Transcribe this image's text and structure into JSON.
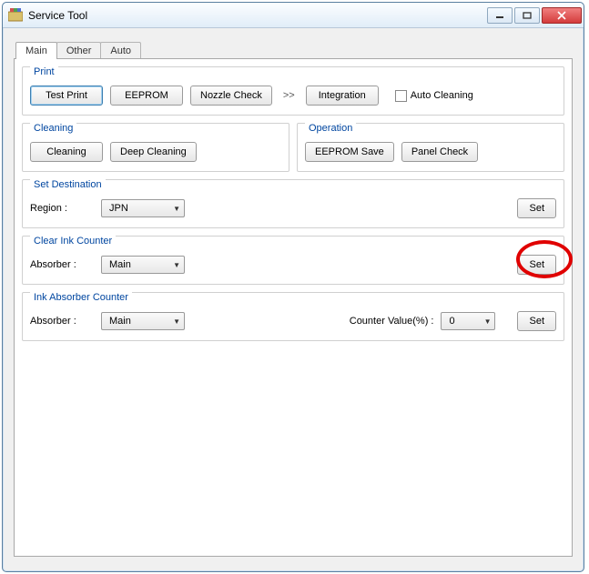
{
  "window": {
    "title": "Service Tool",
    "min_icon": "minimize-icon",
    "max_icon": "maximize-icon",
    "close_icon": "close-icon"
  },
  "tabs": [
    {
      "label": "Main",
      "active": true
    },
    {
      "label": "Other",
      "active": false
    },
    {
      "label": "Auto",
      "active": false
    }
  ],
  "print": {
    "title": "Print",
    "test_print": "Test Print",
    "eeprom": "EEPROM",
    "nozzle_check": "Nozzle Check",
    "chevron": ">>",
    "integration": "Integration",
    "auto_cleaning": "Auto Cleaning",
    "auto_cleaning_checked": false
  },
  "cleaning": {
    "title": "Cleaning",
    "cleaning": "Cleaning",
    "deep_cleaning": "Deep Cleaning"
  },
  "operation": {
    "title": "Operation",
    "eeprom_save": "EEPROM Save",
    "panel_check": "Panel Check"
  },
  "set_dest": {
    "title": "Set Destination",
    "region_label": "Region :",
    "region_value": "JPN",
    "set": "Set"
  },
  "clear_ink": {
    "title": "Clear Ink Counter",
    "absorber_label": "Absorber :",
    "absorber_value": "Main",
    "set": "Set"
  },
  "ink_absorber": {
    "title": "Ink Absorber Counter",
    "absorber_label": "Absorber :",
    "absorber_value": "Main",
    "counter_label": "Counter Value(%) :",
    "counter_value": "0",
    "set": "Set"
  }
}
